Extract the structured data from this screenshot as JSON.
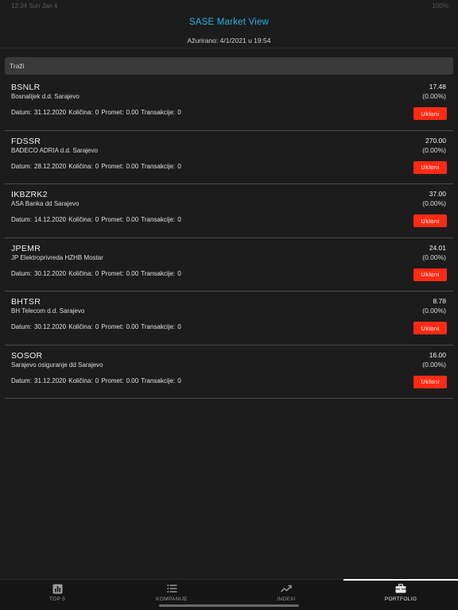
{
  "status_bar": {
    "left": "12:34  Sun Jan 4",
    "right": "100%"
  },
  "header": {
    "title": "SASE Market View",
    "updated": "Ažurirano: 4/1/2021 u 19:54"
  },
  "search": {
    "placeholder": "Traži"
  },
  "stocks": [
    {
      "ticker": "BSNLR",
      "company": "Bosnalijek d.d. Sarajevo",
      "details": "Datum: 31.12.2020  Količina: 0  Promet: 0.00  Transakcije: 0",
      "price": "17.48",
      "change": "(0.00%)",
      "remove": "Ukloni"
    },
    {
      "ticker": "FDSSR",
      "company": "BADECO ADRIA d.d. Sarajevo",
      "details": "Datum: 28.12.2020  Količina: 0  Promet: 0.00  Transakcije: 0",
      "price": "270.00",
      "change": "(0.00%)",
      "remove": "Ukloni"
    },
    {
      "ticker": "IKBZRK2",
      "company": "ASA Banka dd Sarajevo",
      "details": "Datum: 14.12.2020  Količina: 0  Promet: 0.00  Transakcije: 0",
      "price": "37.00",
      "change": "(0.00%)",
      "remove": "Ukloni"
    },
    {
      "ticker": "JPEMR",
      "company": "JP Elektroprivreda HZHB Mostar",
      "details": "Datum: 30.12.2020  Količina: 0  Promet: 0.00  Transakcije: 0",
      "price": "24.01",
      "change": "(0.00%)",
      "remove": "Ukloni"
    },
    {
      "ticker": "BHTSR",
      "company": "BH Telecom d.d. Sarajevo",
      "details": "Datum: 30.12.2020  Količina: 0  Promet: 0.00  Transakcije: 0",
      "price": "8.78",
      "change": "(0.00%)",
      "remove": "Ukloni"
    },
    {
      "ticker": "SOSOR",
      "company": "Sarajevo osiguranje dd Sarajevo",
      "details": "Datum: 31.12.2020  Količina: 0  Promet: 0.00  Transakcije: 0",
      "price": "16.00",
      "change": "(0.00%)",
      "remove": "Ukloni"
    }
  ],
  "tabs": [
    {
      "label": "TOP 5",
      "icon": "bar-chart-icon",
      "active": false
    },
    {
      "label": "KOMPANIJE",
      "icon": "list-icon",
      "active": false
    },
    {
      "label": "INDEXI",
      "icon": "trend-icon",
      "active": false
    },
    {
      "label": "PORTFOLIO",
      "icon": "briefcase-icon",
      "active": true
    }
  ],
  "colors": {
    "accent": "#1fb4e6",
    "remove": "#ff2a14",
    "background": "#1c1c1c"
  }
}
